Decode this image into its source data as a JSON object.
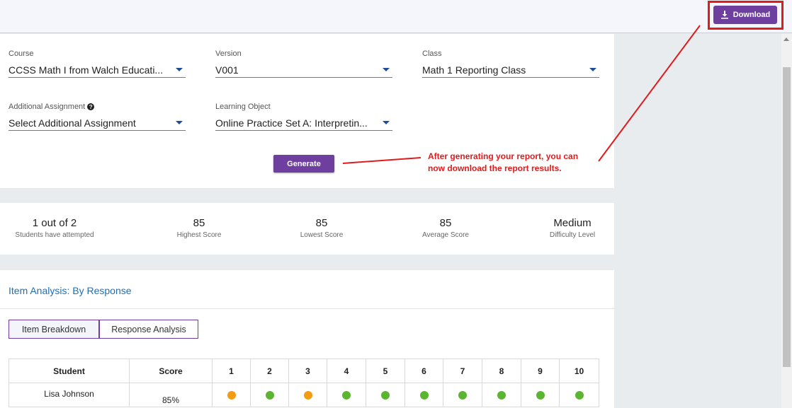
{
  "header": {
    "download_label": "Download"
  },
  "filters": {
    "course": {
      "label": "Course",
      "value": "CCSS Math I from Walch Educati..."
    },
    "version": {
      "label": "Version",
      "value": "V001"
    },
    "class": {
      "label": "Class",
      "value": "Math 1 Reporting Class"
    },
    "additional_assignment": {
      "label": "Additional Assignment",
      "help": "?",
      "value": "Select Additional Assignment"
    },
    "learning_object": {
      "label": "Learning Object",
      "value": "Online Practice Set A: Interpretin..."
    }
  },
  "generate_label": "Generate",
  "annotation": {
    "line1": "After generating your report, you can",
    "line2": "now download the report results."
  },
  "stats": [
    {
      "value": "1 out of 2",
      "caption": "Students have attempted"
    },
    {
      "value": "85",
      "caption": "Highest Score"
    },
    {
      "value": "85",
      "caption": "Lowest Score"
    },
    {
      "value": "85",
      "caption": "Average Score"
    },
    {
      "value": "Medium",
      "caption": "Difficulty Level"
    }
  ],
  "item_analysis": {
    "title": "Item Analysis: By Response",
    "tabs": [
      "Item Breakdown",
      "Response Analysis"
    ],
    "columns": [
      "Student",
      "Score",
      "1",
      "2",
      "3",
      "4",
      "5",
      "6",
      "7",
      "8",
      "9",
      "10"
    ],
    "rows": [
      {
        "student": "Lisa Johnson",
        "score": "85%",
        "items": [
          "partial",
          "correct",
          "partial",
          "correct",
          "correct",
          "correct",
          "correct",
          "correct",
          "correct",
          "correct"
        ]
      }
    ]
  },
  "colors": {
    "accent": "#6f3fa0",
    "link": "#1e6fb8",
    "annotation": "#e01b1b",
    "correct": "#5cb531",
    "partial": "#f39b12"
  }
}
